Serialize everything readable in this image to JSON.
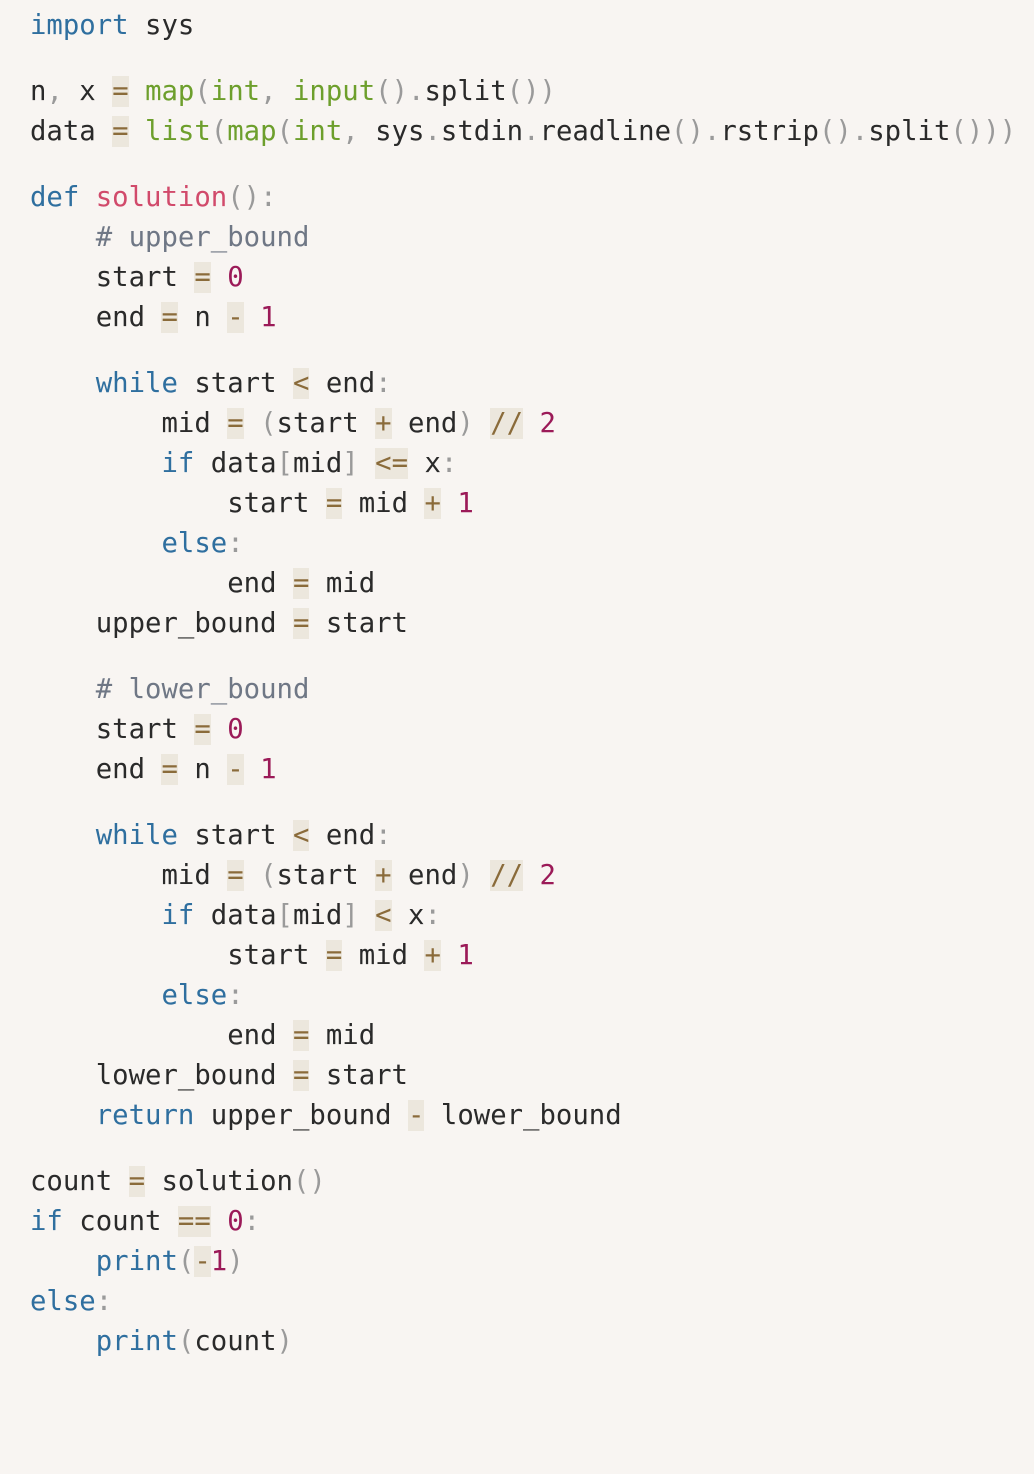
{
  "code": {
    "language": "python",
    "lines": [
      [
        {
          "t": "keyword",
          "v": "import"
        },
        {
          "t": "plain",
          "v": " sys"
        }
      ],
      [],
      [
        {
          "t": "plain",
          "v": "n"
        },
        {
          "t": "punct",
          "v": ","
        },
        {
          "t": "plain",
          "v": " x "
        },
        {
          "t": "op",
          "v": "="
        },
        {
          "t": "plain",
          "v": " "
        },
        {
          "t": "builtin",
          "v": "map"
        },
        {
          "t": "punct",
          "v": "("
        },
        {
          "t": "builtin",
          "v": "int"
        },
        {
          "t": "punct",
          "v": ","
        },
        {
          "t": "plain",
          "v": " "
        },
        {
          "t": "builtin",
          "v": "input"
        },
        {
          "t": "punct",
          "v": "()."
        },
        {
          "t": "plain",
          "v": "split"
        },
        {
          "t": "punct",
          "v": "())"
        }
      ],
      [
        {
          "t": "plain",
          "v": "data "
        },
        {
          "t": "op",
          "v": "="
        },
        {
          "t": "plain",
          "v": " "
        },
        {
          "t": "builtin",
          "v": "list"
        },
        {
          "t": "punct",
          "v": "("
        },
        {
          "t": "builtin",
          "v": "map"
        },
        {
          "t": "punct",
          "v": "("
        },
        {
          "t": "builtin",
          "v": "int"
        },
        {
          "t": "punct",
          "v": ","
        },
        {
          "t": "plain",
          "v": " sys"
        },
        {
          "t": "punct",
          "v": "."
        },
        {
          "t": "plain",
          "v": "stdin"
        },
        {
          "t": "punct",
          "v": "."
        },
        {
          "t": "plain",
          "v": "readline"
        },
        {
          "t": "punct",
          "v": "()."
        },
        {
          "t": "plain",
          "v": "rstrip"
        },
        {
          "t": "punct",
          "v": "()."
        },
        {
          "t": "plain",
          "v": "split"
        },
        {
          "t": "punct",
          "v": "()))"
        }
      ],
      [],
      [
        {
          "t": "keyword",
          "v": "def"
        },
        {
          "t": "plain",
          "v": " "
        },
        {
          "t": "func",
          "v": "solution"
        },
        {
          "t": "punct",
          "v": "():"
        }
      ],
      [
        {
          "t": "plain",
          "v": "    "
        },
        {
          "t": "comment",
          "v": "# upper_bound"
        }
      ],
      [
        {
          "t": "plain",
          "v": "    start "
        },
        {
          "t": "op",
          "v": "="
        },
        {
          "t": "plain",
          "v": " "
        },
        {
          "t": "number",
          "v": "0"
        }
      ],
      [
        {
          "t": "plain",
          "v": "    end "
        },
        {
          "t": "op",
          "v": "="
        },
        {
          "t": "plain",
          "v": " n "
        },
        {
          "t": "op",
          "v": "-"
        },
        {
          "t": "plain",
          "v": " "
        },
        {
          "t": "number",
          "v": "1"
        }
      ],
      [],
      [
        {
          "t": "plain",
          "v": "    "
        },
        {
          "t": "keyword",
          "v": "while"
        },
        {
          "t": "plain",
          "v": " start "
        },
        {
          "t": "op",
          "v": "<"
        },
        {
          "t": "plain",
          "v": " end"
        },
        {
          "t": "punct",
          "v": ":"
        }
      ],
      [
        {
          "t": "plain",
          "v": "        mid "
        },
        {
          "t": "op",
          "v": "="
        },
        {
          "t": "plain",
          "v": " "
        },
        {
          "t": "punct",
          "v": "("
        },
        {
          "t": "plain",
          "v": "start "
        },
        {
          "t": "op",
          "v": "+"
        },
        {
          "t": "plain",
          "v": " end"
        },
        {
          "t": "punct",
          "v": ")"
        },
        {
          "t": "plain",
          "v": " "
        },
        {
          "t": "op",
          "v": "//"
        },
        {
          "t": "plain",
          "v": " "
        },
        {
          "t": "number",
          "v": "2"
        }
      ],
      [
        {
          "t": "plain",
          "v": "        "
        },
        {
          "t": "keyword",
          "v": "if"
        },
        {
          "t": "plain",
          "v": " data"
        },
        {
          "t": "punct",
          "v": "["
        },
        {
          "t": "plain",
          "v": "mid"
        },
        {
          "t": "punct",
          "v": "]"
        },
        {
          "t": "plain",
          "v": " "
        },
        {
          "t": "op",
          "v": "<="
        },
        {
          "t": "plain",
          "v": " x"
        },
        {
          "t": "punct",
          "v": ":"
        }
      ],
      [
        {
          "t": "plain",
          "v": "            start "
        },
        {
          "t": "op",
          "v": "="
        },
        {
          "t": "plain",
          "v": " mid "
        },
        {
          "t": "op",
          "v": "+"
        },
        {
          "t": "plain",
          "v": " "
        },
        {
          "t": "number",
          "v": "1"
        }
      ],
      [
        {
          "t": "plain",
          "v": "        "
        },
        {
          "t": "keyword",
          "v": "else"
        },
        {
          "t": "punct",
          "v": ":"
        }
      ],
      [
        {
          "t": "plain",
          "v": "            end "
        },
        {
          "t": "op",
          "v": "="
        },
        {
          "t": "plain",
          "v": " mid"
        }
      ],
      [
        {
          "t": "plain",
          "v": "    upper_bound "
        },
        {
          "t": "op",
          "v": "="
        },
        {
          "t": "plain",
          "v": " start"
        }
      ],
      [],
      [
        {
          "t": "plain",
          "v": "    "
        },
        {
          "t": "comment",
          "v": "# lower_bound"
        }
      ],
      [
        {
          "t": "plain",
          "v": "    start "
        },
        {
          "t": "op",
          "v": "="
        },
        {
          "t": "plain",
          "v": " "
        },
        {
          "t": "number",
          "v": "0"
        }
      ],
      [
        {
          "t": "plain",
          "v": "    end "
        },
        {
          "t": "op",
          "v": "="
        },
        {
          "t": "plain",
          "v": " n "
        },
        {
          "t": "op",
          "v": "-"
        },
        {
          "t": "plain",
          "v": " "
        },
        {
          "t": "number",
          "v": "1"
        }
      ],
      [],
      [
        {
          "t": "plain",
          "v": "    "
        },
        {
          "t": "keyword",
          "v": "while"
        },
        {
          "t": "plain",
          "v": " start "
        },
        {
          "t": "op",
          "v": "<"
        },
        {
          "t": "plain",
          "v": " end"
        },
        {
          "t": "punct",
          "v": ":"
        }
      ],
      [
        {
          "t": "plain",
          "v": "        mid "
        },
        {
          "t": "op",
          "v": "="
        },
        {
          "t": "plain",
          "v": " "
        },
        {
          "t": "punct",
          "v": "("
        },
        {
          "t": "plain",
          "v": "start "
        },
        {
          "t": "op",
          "v": "+"
        },
        {
          "t": "plain",
          "v": " end"
        },
        {
          "t": "punct",
          "v": ")"
        },
        {
          "t": "plain",
          "v": " "
        },
        {
          "t": "op",
          "v": "//"
        },
        {
          "t": "plain",
          "v": " "
        },
        {
          "t": "number",
          "v": "2"
        }
      ],
      [
        {
          "t": "plain",
          "v": "        "
        },
        {
          "t": "keyword",
          "v": "if"
        },
        {
          "t": "plain",
          "v": " data"
        },
        {
          "t": "punct",
          "v": "["
        },
        {
          "t": "plain",
          "v": "mid"
        },
        {
          "t": "punct",
          "v": "]"
        },
        {
          "t": "plain",
          "v": " "
        },
        {
          "t": "op",
          "v": "<"
        },
        {
          "t": "plain",
          "v": " x"
        },
        {
          "t": "punct",
          "v": ":"
        }
      ],
      [
        {
          "t": "plain",
          "v": "            start "
        },
        {
          "t": "op",
          "v": "="
        },
        {
          "t": "plain",
          "v": " mid "
        },
        {
          "t": "op",
          "v": "+"
        },
        {
          "t": "plain",
          "v": " "
        },
        {
          "t": "number",
          "v": "1"
        }
      ],
      [
        {
          "t": "plain",
          "v": "        "
        },
        {
          "t": "keyword",
          "v": "else"
        },
        {
          "t": "punct",
          "v": ":"
        }
      ],
      [
        {
          "t": "plain",
          "v": "            end "
        },
        {
          "t": "op",
          "v": "="
        },
        {
          "t": "plain",
          "v": " mid"
        }
      ],
      [
        {
          "t": "plain",
          "v": "    lower_bound "
        },
        {
          "t": "op",
          "v": "="
        },
        {
          "t": "plain",
          "v": " start"
        }
      ],
      [
        {
          "t": "plain",
          "v": "    "
        },
        {
          "t": "keyword",
          "v": "return"
        },
        {
          "t": "plain",
          "v": " upper_bound "
        },
        {
          "t": "op",
          "v": "-"
        },
        {
          "t": "plain",
          "v": " lower_bound"
        }
      ],
      [],
      [
        {
          "t": "plain",
          "v": "count "
        },
        {
          "t": "op",
          "v": "="
        },
        {
          "t": "plain",
          "v": " solution"
        },
        {
          "t": "punct",
          "v": "()"
        }
      ],
      [
        {
          "t": "keyword",
          "v": "if"
        },
        {
          "t": "plain",
          "v": " count "
        },
        {
          "t": "op",
          "v": "=="
        },
        {
          "t": "plain",
          "v": " "
        },
        {
          "t": "number",
          "v": "0"
        },
        {
          "t": "punct",
          "v": ":"
        }
      ],
      [
        {
          "t": "plain",
          "v": "    "
        },
        {
          "t": "keyword",
          "v": "print"
        },
        {
          "t": "punct",
          "v": "("
        },
        {
          "t": "op",
          "v": "-"
        },
        {
          "t": "number",
          "v": "1"
        },
        {
          "t": "punct",
          "v": ")"
        }
      ],
      [
        {
          "t": "keyword",
          "v": "else"
        },
        {
          "t": "punct",
          "v": ":"
        }
      ],
      [
        {
          "t": "plain",
          "v": "    "
        },
        {
          "t": "keyword",
          "v": "print"
        },
        {
          "t": "punct",
          "v": "("
        },
        {
          "t": "plain",
          "v": "count"
        },
        {
          "t": "punct",
          "v": ")"
        }
      ]
    ]
  },
  "colors": {
    "background": "#f8f5f2",
    "keyword": "#2f6f9f",
    "builtin": "#6d9f2c",
    "function": "#d14a6b",
    "number": "#9b1a58",
    "comment": "#6f7785",
    "operator": "#8a6b3a",
    "punctuation": "#9a9a9a",
    "text": "#2a2a2a"
  }
}
